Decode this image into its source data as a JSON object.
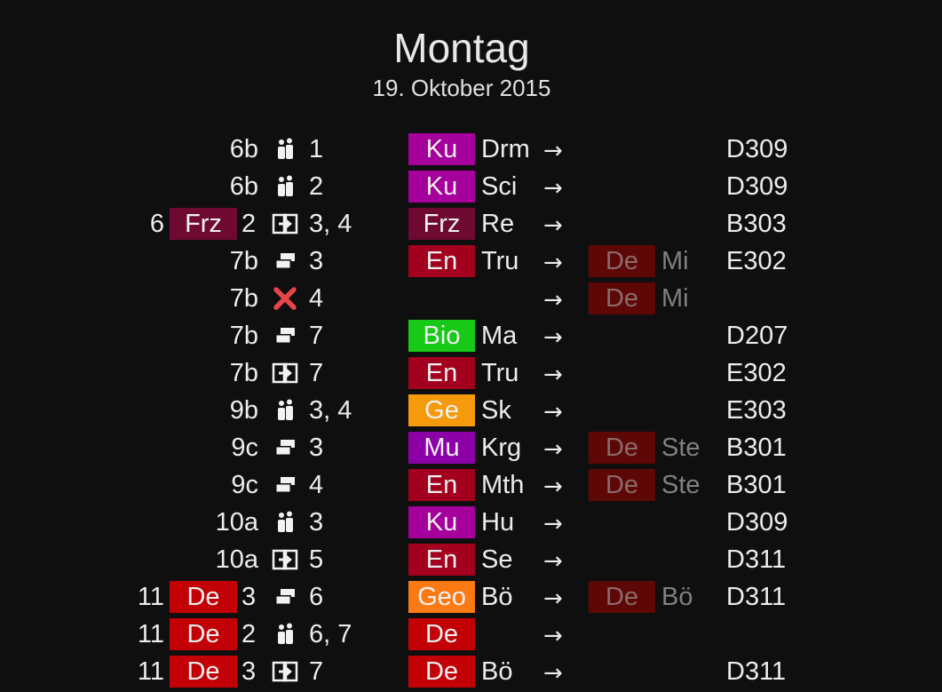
{
  "header": {
    "day": "Montag",
    "date": "19. Oktober 2015"
  },
  "colors": {
    "background": "#0f0f0f",
    "Ku": "#a5009c",
    "Frz": "#6e0a32",
    "En": "#a2001e",
    "Bio": "#18c918",
    "Ge": "#f59a0b",
    "Mu": "#8c00a8",
    "Geo": "#fb7a14",
    "De": "#c20006",
    "De_replacement": "#5d0707"
  },
  "arrow": "→",
  "rows": [
    {
      "cls": "6b",
      "icon": "people-icon",
      "hours": "1",
      "subj": "Ku",
      "subj_color": "#a5009c",
      "teacher": "Drm",
      "room": "D309"
    },
    {
      "cls": "6b",
      "icon": "people-icon",
      "hours": "2",
      "subj": "Ku",
      "subj_color": "#a5009c",
      "teacher": "Sci",
      "room": "D309"
    },
    {
      "num": "6",
      "pre": "Frz",
      "pre_color": "#6e0a32",
      "pcount": "2",
      "icon": "swap-icon",
      "hours": "3, 4",
      "subj": "Frz",
      "subj_color": "#6e0a32",
      "teacher": "Re",
      "room": "B303"
    },
    {
      "cls": "7b",
      "icon": "stack-icon",
      "hours": "3",
      "subj": "En",
      "subj_color": "#a2001e",
      "teacher": "Tru",
      "rsubj": "De",
      "rteacher": "Mi",
      "room": "E302"
    },
    {
      "cls": "7b",
      "icon": "cancel-icon",
      "hours": "4",
      "rsubj": "De",
      "rteacher": "Mi"
    },
    {
      "cls": "7b",
      "icon": "stack-icon",
      "hours": "7",
      "subj": "Bio",
      "subj_color": "#18c918",
      "teacher": "Ma",
      "room": "D207"
    },
    {
      "cls": "7b",
      "icon": "swap-icon",
      "hours": "7",
      "subj": "En",
      "subj_color": "#a2001e",
      "teacher": "Tru",
      "room": "E302"
    },
    {
      "cls": "9b",
      "icon": "people-icon",
      "hours": "3, 4",
      "subj": "Ge",
      "subj_color": "#f59a0b",
      "teacher": "Sk",
      "room": "E303"
    },
    {
      "cls": "9c",
      "icon": "stack-icon",
      "hours": "3",
      "subj": "Mu",
      "subj_color": "#8c00a8",
      "teacher": "Krg",
      "rsubj": "De",
      "rteacher": "Ste",
      "room": "B301"
    },
    {
      "cls": "9c",
      "icon": "stack-icon",
      "hours": "4",
      "subj": "En",
      "subj_color": "#a2001e",
      "teacher": "Mth",
      "rsubj": "De",
      "rteacher": "Ste",
      "room": "B301"
    },
    {
      "cls": "10a",
      "icon": "people-icon",
      "hours": "3",
      "subj": "Ku",
      "subj_color": "#a5009c",
      "teacher": "Hu",
      "room": "D309"
    },
    {
      "cls": "10a",
      "icon": "swap-icon",
      "hours": "5",
      "subj": "En",
      "subj_color": "#a2001e",
      "teacher": "Se",
      "room": "D311"
    },
    {
      "num": "11",
      "pre": "De",
      "pre_color": "#c20006",
      "pcount": "3",
      "icon": "stack-icon",
      "hours": "6",
      "subj": "Geo",
      "subj_color": "#fb7a14",
      "teacher": "Bö",
      "rsubj": "De",
      "rteacher": "Bö",
      "room": "D311"
    },
    {
      "num": "11",
      "pre": "De",
      "pre_color": "#c20006",
      "pcount": "2",
      "icon": "people-icon",
      "hours": "6, 7",
      "subj": "De",
      "subj_color": "#c20006",
      "teacher": ""
    },
    {
      "num": "11",
      "pre": "De",
      "pre_color": "#c20006",
      "pcount": "3",
      "icon": "swap-icon",
      "hours": "7",
      "subj": "De",
      "subj_color": "#c20006",
      "teacher": "Bö",
      "room": "D311"
    }
  ]
}
